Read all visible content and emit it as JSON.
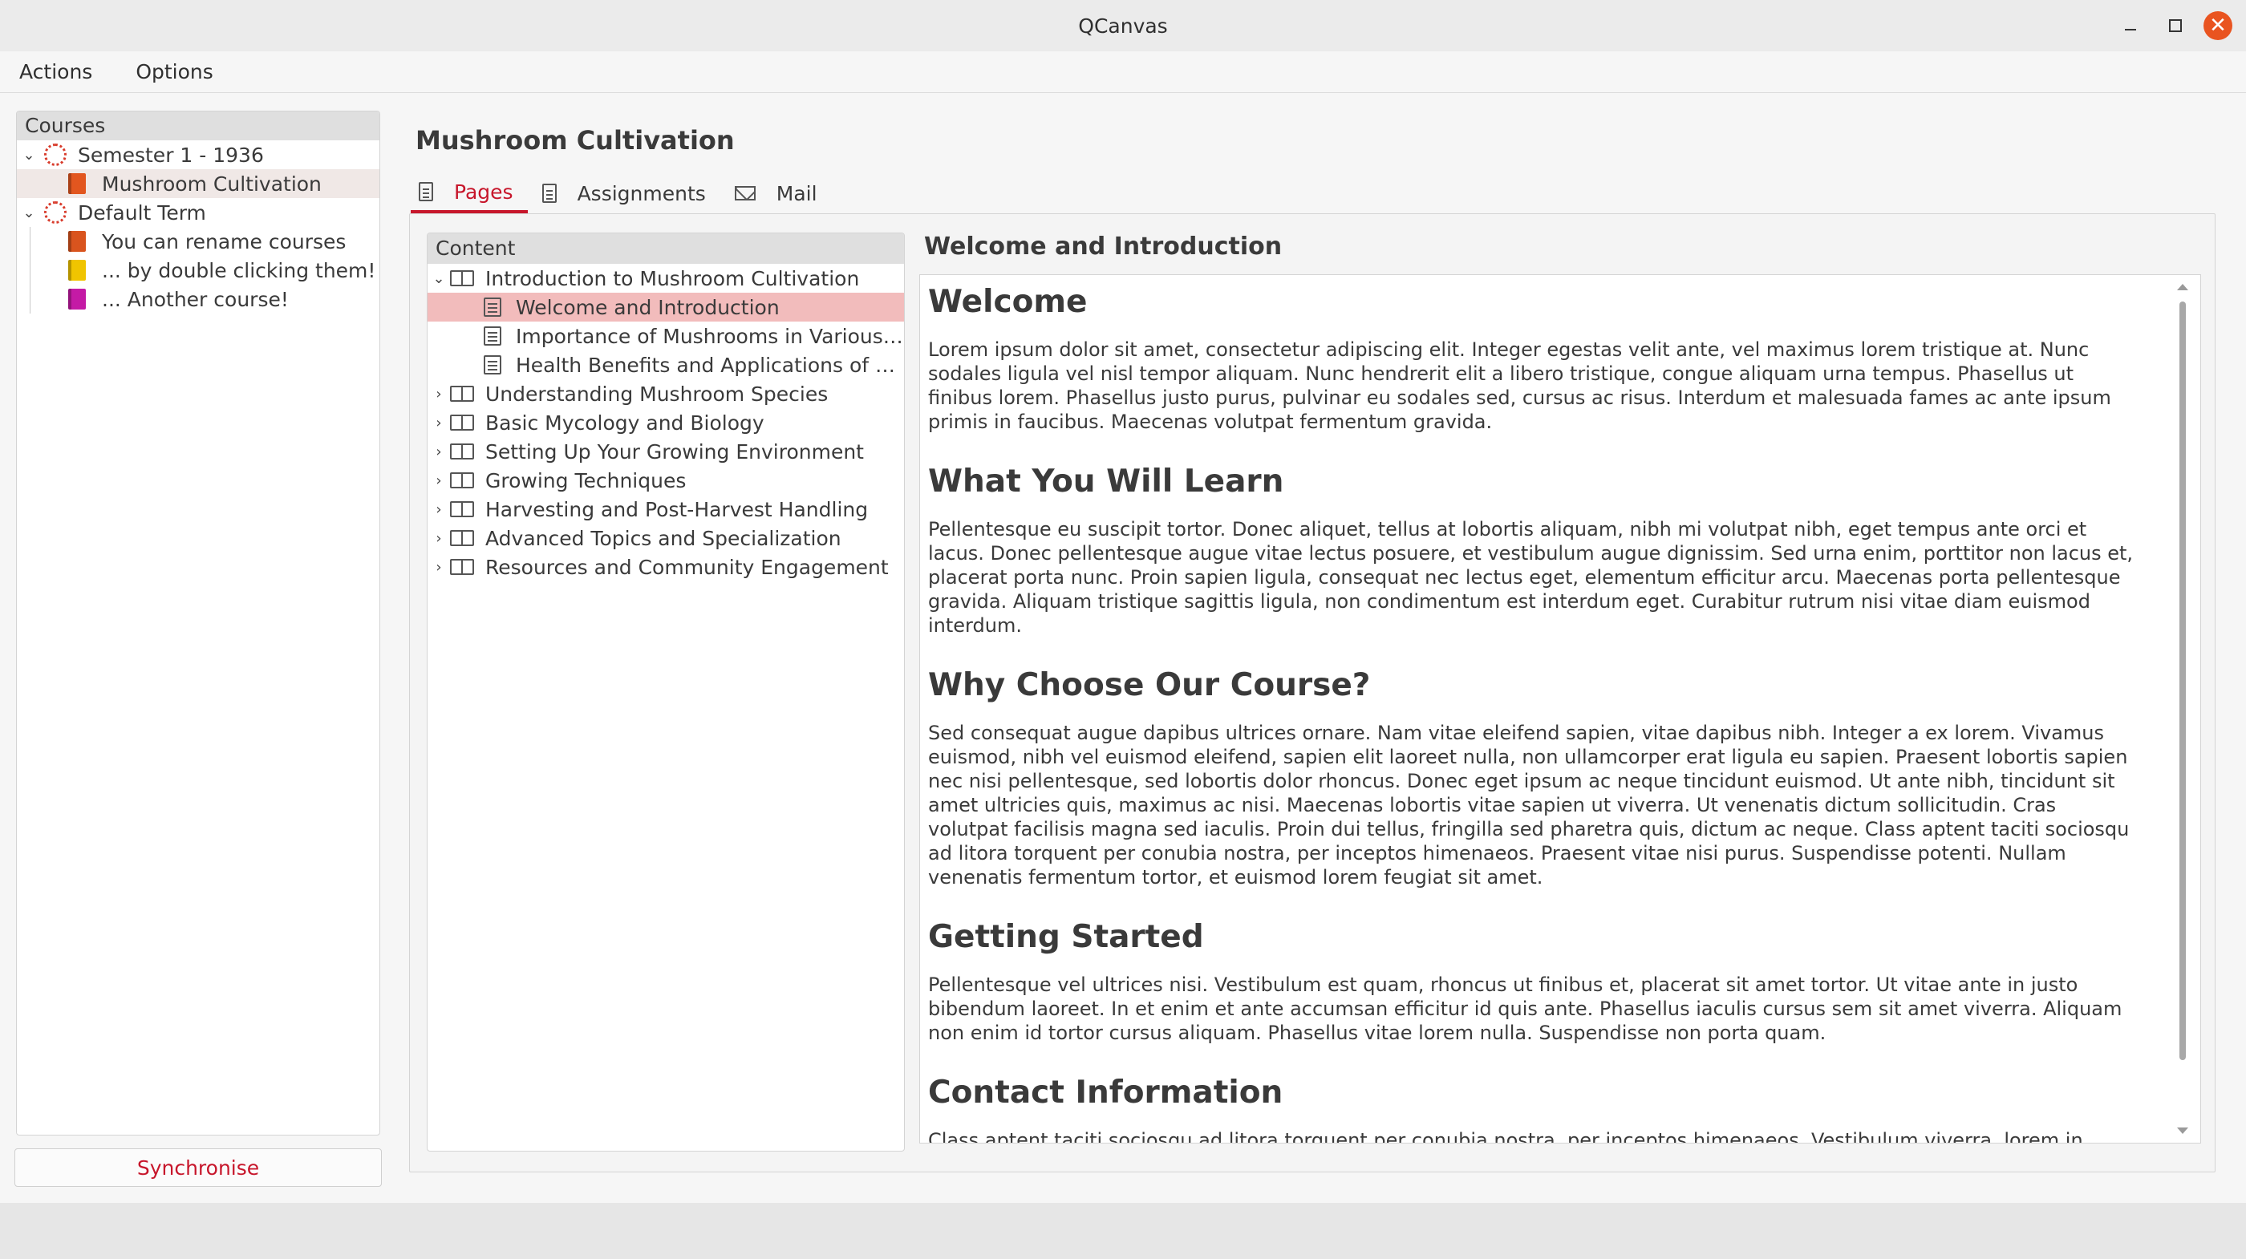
{
  "window": {
    "title": "QCanvas"
  },
  "menu": {
    "items": [
      "Actions",
      "Options"
    ]
  },
  "courses": {
    "header": "Courses",
    "terms": [
      {
        "label": "Semester 1 - 1936",
        "courses": [
          {
            "label": "Mushroom Cultivation",
            "color": "#e2561f"
          }
        ]
      },
      {
        "label": "Default Term",
        "courses": [
          {
            "label": "You can rename courses",
            "color": "#d9541e"
          },
          {
            "label": "... by double clicking them!",
            "color": "#f0c400"
          },
          {
            "label": "... Another course!",
            "color": "#c41aa5"
          }
        ]
      }
    ]
  },
  "sync_button": "Synchronise",
  "course_title": "Mushroom Cultivation",
  "tabs": [
    "Pages",
    "Assignments",
    "Mail"
  ],
  "content": {
    "header": "Content",
    "items": [
      {
        "label": "Introduction to Mushroom Cultivation",
        "expanded": true,
        "children": [
          "Welcome and Introduction",
          "Importance of Mushrooms in Various ...",
          "Health Benefits and Applications of M..."
        ]
      },
      {
        "label": "Understanding Mushroom Species"
      },
      {
        "label": "Basic Mycology and Biology"
      },
      {
        "label": "Setting Up Your Growing Environment"
      },
      {
        "label": "Growing Techniques"
      },
      {
        "label": "Harvesting and Post-Harvest Handling"
      },
      {
        "label": "Advanced Topics and Specialization"
      },
      {
        "label": "Resources and Community Engagement"
      }
    ]
  },
  "page": {
    "heading": "Welcome and Introduction",
    "sections": [
      {
        "title": "Welcome",
        "body": "Lorem ipsum dolor sit amet, consectetur adipiscing elit. Integer egestas velit ante, vel maximus lorem tristique at. Nunc sodales ligula vel nisl tempor aliquam. Nunc hendrerit elit a libero tristique, congue aliquam urna tempus. Phasellus ut finibus lorem. Phasellus justo purus, pulvinar eu sodales sed, cursus ac risus. Interdum et malesuada fames ac ante ipsum primis in faucibus. Maecenas volutpat fermentum gravida."
      },
      {
        "title": "What You Will Learn",
        "body": "Pellentesque eu suscipit tortor. Donec aliquet, tellus at lobortis aliquam, nibh mi volutpat nibh, eget tempus ante orci et lacus. Donec pellentesque augue vitae lectus posuere, et vestibulum augue dignissim. Sed urna enim, porttitor non lacus et, placerat porta nunc. Proin sapien ligula, consequat nec lectus eget, elementum efficitur arcu. Maecenas porta pellentesque gravida. Aliquam tristique sagittis ligula, non condimentum est interdum eget. Curabitur rutrum nisi vitae diam euismod interdum."
      },
      {
        "title": "Why Choose Our Course?",
        "body": "Sed consequat augue dapibus ultrices ornare. Nam vitae eleifend sapien, vitae dapibus nibh. Integer a ex lorem. Vivamus euismod, nibh vel euismod eleifend, sapien elit laoreet nulla, non ullamcorper erat ligula eu sapien. Praesent lobortis sapien nec nisi pellentesque, sed lobortis dolor rhoncus. Donec eget ipsum ac neque tincidunt euismod. Ut ante nibh, tincidunt sit amet ultricies quis, maximus ac nisi. Maecenas lobortis vitae sapien ut viverra. Ut venenatis dictum sollicitudin. Cras volutpat facilisis magna sed iaculis. Proin dui tellus, fringilla sed pharetra quis, dictum ac neque. Class aptent taciti sociosqu ad litora torquent per conubia nostra, per inceptos himenaeos. Praesent vitae nisi purus. Suspendisse potenti. Nullam venenatis fermentum tortor, et euismod lorem feugiat sit amet."
      },
      {
        "title": "Getting Started",
        "body": "Pellentesque vel ultrices nisi. Vestibulum est quam, rhoncus ut finibus et, placerat sit amet tortor. Ut vitae ante in justo bibendum laoreet. In et enim et ante accumsan efficitur id quis ante. Phasellus iaculis cursus sem sit amet viverra. Aliquam non enim id tortor cursus aliquam. Phasellus vitae lorem nulla. Suspendisse non porta quam."
      },
      {
        "title": "Contact Information",
        "body": "Class aptent taciti sociosqu ad litora torquent per conubia nostra, per inceptos himenaeos. Vestibulum viverra, lorem in maximus pellentesque, neque nisi fringilla nulla, luctus porttitor augue neque eu lacus. Cras pharetra porta facilisis. Nulla scelerisque in"
      }
    ]
  },
  "colors": {
    "accent": "#c7162b",
    "selection": "#f2bcbc",
    "close": "#e95420"
  }
}
